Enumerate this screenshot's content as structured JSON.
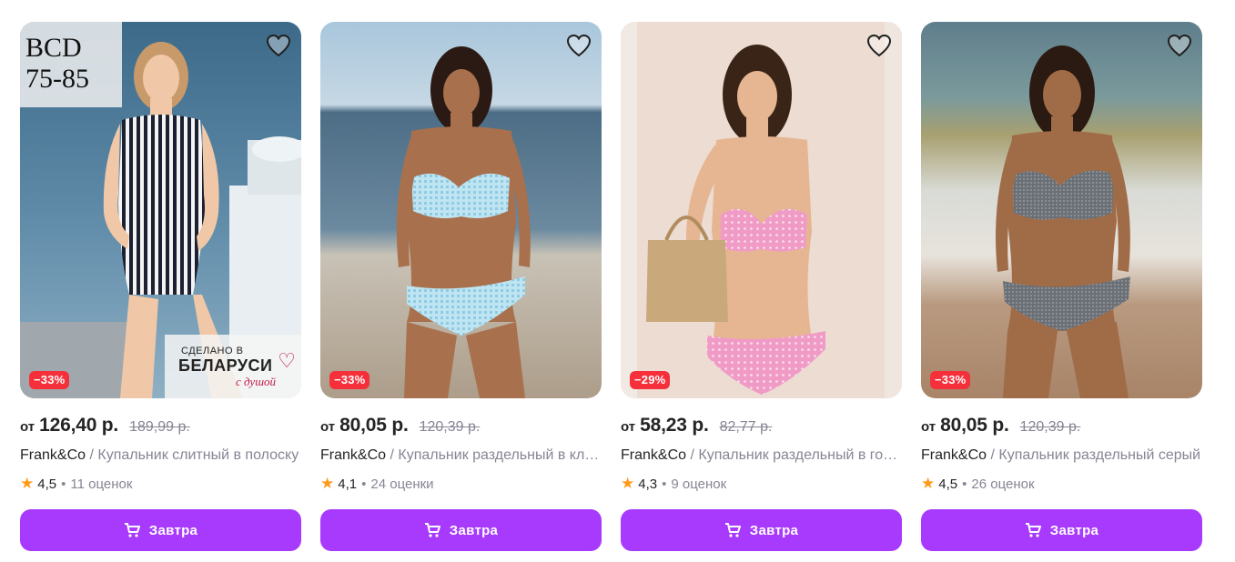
{
  "products": [
    {
      "price_from": "от",
      "price": "126,40 р.",
      "old_price": "189,99 р.",
      "brand": "Frank&Co",
      "name": " / Купальник слитный в полоску",
      "rating": "4,5",
      "reviews": "11 оценок",
      "discount": "−33%",
      "button": "Завтра",
      "badge_size_line1": "BCD",
      "badge_size_line2": "75-85",
      "badge_made_line1": "СДЕЛАНО В",
      "badge_made_line2": "БЕЛАРУСИ",
      "badge_made_line3": "с душой",
      "favorite_icon": "heart-icon"
    },
    {
      "price_from": "от",
      "price": "80,05 р.",
      "old_price": "120,39 р.",
      "brand": "Frank&Co",
      "name": " / Купальник раздельный в клетку",
      "rating": "4,1",
      "reviews": "24 оценки",
      "discount": "−33%",
      "button": "Завтра",
      "favorite_icon": "heart-icon"
    },
    {
      "price_from": "от",
      "price": "58,23 р.",
      "old_price": "82,77 р.",
      "brand": "Frank&Co",
      "name": " / Купальник раздельный в горошек",
      "rating": "4,3",
      "reviews": "9 оценок",
      "discount": "−29%",
      "button": "Завтра",
      "favorite_icon": "heart-icon"
    },
    {
      "price_from": "от",
      "price": "80,05 р.",
      "old_price": "120,39 р.",
      "brand": "Frank&Co",
      "name": " / Купальник раздельный серый",
      "rating": "4,5",
      "reviews": "26 оценок",
      "discount": "−33%",
      "button": "Завтра",
      "favorite_icon": "heart-icon"
    }
  ],
  "colors": {
    "accent": "#a73afd",
    "discount": "#f5303b",
    "star": "#ff9a19",
    "muted": "#868695"
  }
}
